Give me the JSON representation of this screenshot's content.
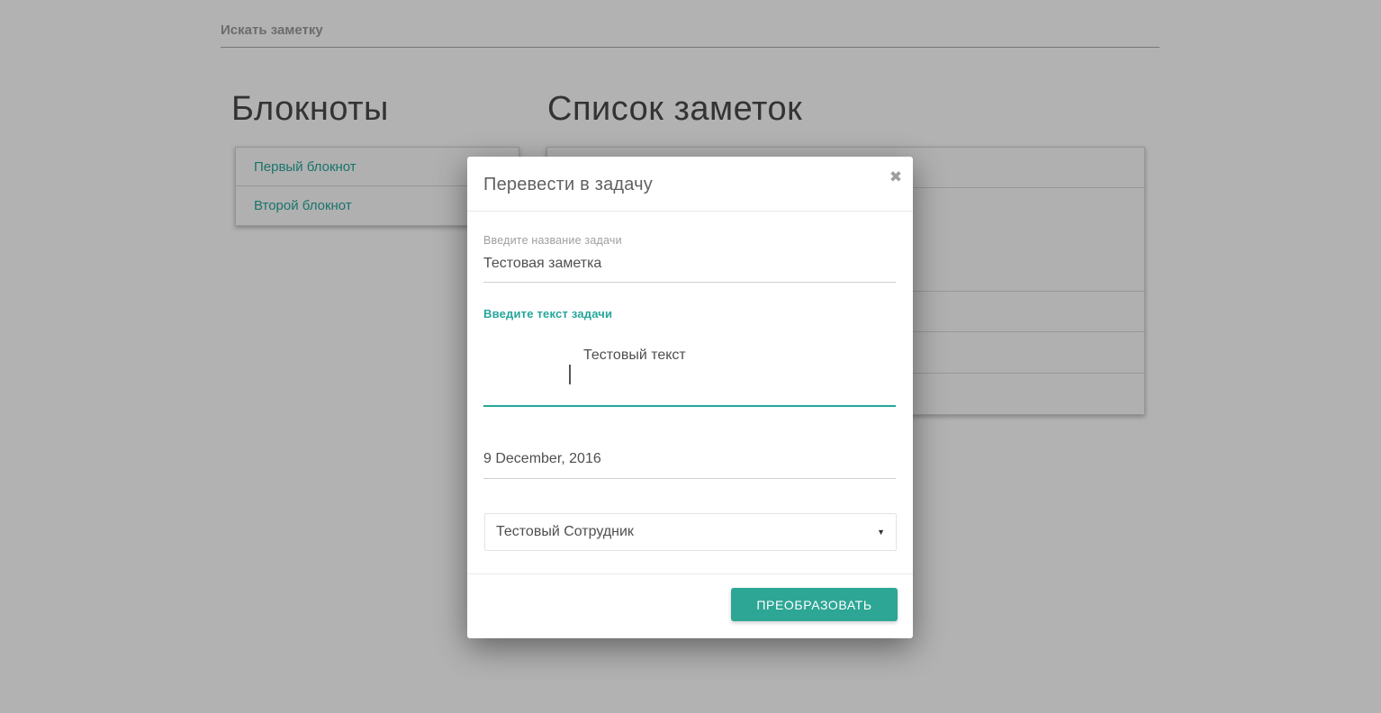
{
  "colors": {
    "accent": "#26a69a",
    "button": "#2da695",
    "overlay": "rgba(0,0,0,0.30)"
  },
  "search": {
    "placeholder": "Искать заметку"
  },
  "notebooks": {
    "title": "Блокноты",
    "items": [
      {
        "label": "Первый блокнот"
      },
      {
        "label": "Второй блокнот"
      }
    ]
  },
  "notes": {
    "title": "Список заметок",
    "visible_rows": 5
  },
  "modal": {
    "title": "Перевести в задачу",
    "close_icon": "✖",
    "name_field": {
      "label": "Введите название задачи",
      "value": "Тестовая заметка"
    },
    "text_field": {
      "label": "Введите текст задачи",
      "value": "Тестовый текст"
    },
    "date_field": {
      "value": "9 December, 2016"
    },
    "assignee_select": {
      "value": "Тестовый Сотрудник",
      "arrow": "▼"
    },
    "submit_label": "ПРЕОБРАЗОВАТЬ"
  }
}
